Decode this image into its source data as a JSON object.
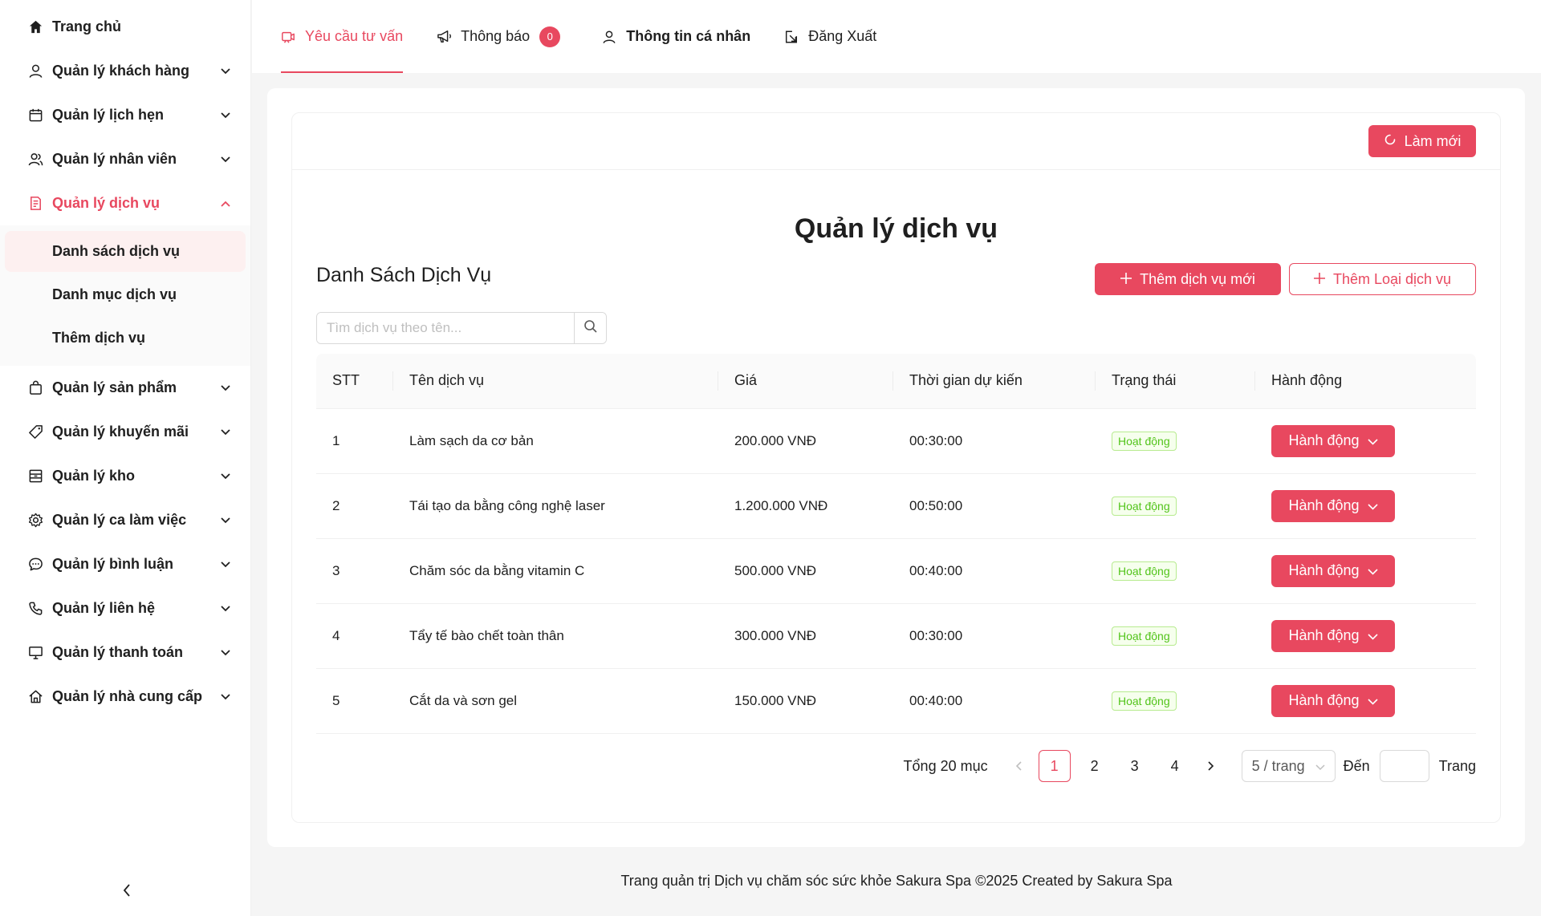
{
  "colors": {
    "accent": "#e8485f",
    "success": "#52c41a"
  },
  "sidebar": {
    "items": [
      {
        "label": "Trang chủ",
        "icon": "home-icon",
        "has_children": false
      },
      {
        "label": "Quản lý khách hàng",
        "icon": "user-icon",
        "has_children": true
      },
      {
        "label": "Quản lý lịch hẹn",
        "icon": "calendar-icon",
        "has_children": true
      },
      {
        "label": "Quản lý nhân viên",
        "icon": "team-icon",
        "has_children": true
      },
      {
        "label": "Quản lý dịch vụ",
        "icon": "file-list-icon",
        "has_children": true,
        "expanded": true,
        "children": [
          "Danh sách dịch vụ",
          "Danh mục dịch vụ",
          "Thêm dịch vụ"
        ],
        "selected_child": "Danh sách dịch vụ"
      },
      {
        "label": "Quản lý sản phẩm",
        "icon": "shopping-bag-icon",
        "has_children": true
      },
      {
        "label": "Quản lý khuyến mãi",
        "icon": "tag-icon",
        "has_children": true
      },
      {
        "label": "Quản lý kho",
        "icon": "warehouse-icon",
        "has_children": true
      },
      {
        "label": "Quản lý ca làm việc",
        "icon": "gear-icon",
        "has_children": true
      },
      {
        "label": "Quản lý bình luận",
        "icon": "comment-icon",
        "has_children": true
      },
      {
        "label": "Quản lý liên hệ",
        "icon": "phone-icon",
        "has_children": true
      },
      {
        "label": "Quản lý thanh toán",
        "icon": "monitor-icon",
        "has_children": true
      },
      {
        "label": "Quản lý nhà cung cấp",
        "icon": "house-icon",
        "has_children": true
      }
    ]
  },
  "topnav": {
    "tabs": [
      {
        "label": "Yêu cầu tư vấn",
        "icon": "consult-icon",
        "active": true
      },
      {
        "label": "Thông báo",
        "icon": "megaphone-icon",
        "badge": "0"
      },
      {
        "label": "Thông tin cá nhân",
        "icon": "user-icon"
      },
      {
        "label": "Đăng Xuất",
        "icon": "logout-icon"
      }
    ]
  },
  "main": {
    "refresh_label": "Làm mới",
    "page_title": "Quản lý dịch vụ",
    "list_title": "Danh Sách Dịch Vụ",
    "add_service_label": "Thêm dịch vụ mới",
    "add_type_label": "Thêm Loại dịch vụ",
    "search_placeholder": "Tìm dịch vụ theo tên...",
    "search_value": "",
    "table": {
      "columns": [
        "STT",
        "Tên dịch vụ",
        "Giá",
        "Thời gian dự kiến",
        "Trạng thái",
        "Hành động"
      ],
      "rows": [
        {
          "stt": "1",
          "name": "Làm sạch da cơ bản",
          "price": "200.000 VNĐ",
          "duration": "00:30:00",
          "status": "Hoạt động",
          "action": "Hành động"
        },
        {
          "stt": "2",
          "name": "Tái tạo da bằng công nghệ laser",
          "price": "1.200.000 VNĐ",
          "duration": "00:50:00",
          "status": "Hoạt động",
          "action": "Hành động"
        },
        {
          "stt": "3",
          "name": "Chăm sóc da bằng vitamin C",
          "price": "500.000 VNĐ",
          "duration": "00:40:00",
          "status": "Hoạt động",
          "action": "Hành động"
        },
        {
          "stt": "4",
          "name": "Tẩy tế bào chết toàn thân",
          "price": "300.000 VNĐ",
          "duration": "00:30:00",
          "status": "Hoạt động",
          "action": "Hành động"
        },
        {
          "stt": "5",
          "name": "Cắt da và sơn gel",
          "price": "150.000 VNĐ",
          "duration": "00:40:00",
          "status": "Hoạt động",
          "action": "Hành động"
        }
      ]
    },
    "pagination": {
      "total": "Tổng 20 mục",
      "pages": [
        "1",
        "2",
        "3",
        "4"
      ],
      "current": "1",
      "page_size": "5 / trang",
      "goto_label": "Đến",
      "goto_value": "",
      "page_suffix": "Trang"
    }
  },
  "footer": {
    "text": "Trang quản trị Dịch vụ chăm sóc sức khỏe Sakura Spa ©2025 Created by Sakura Spa"
  }
}
